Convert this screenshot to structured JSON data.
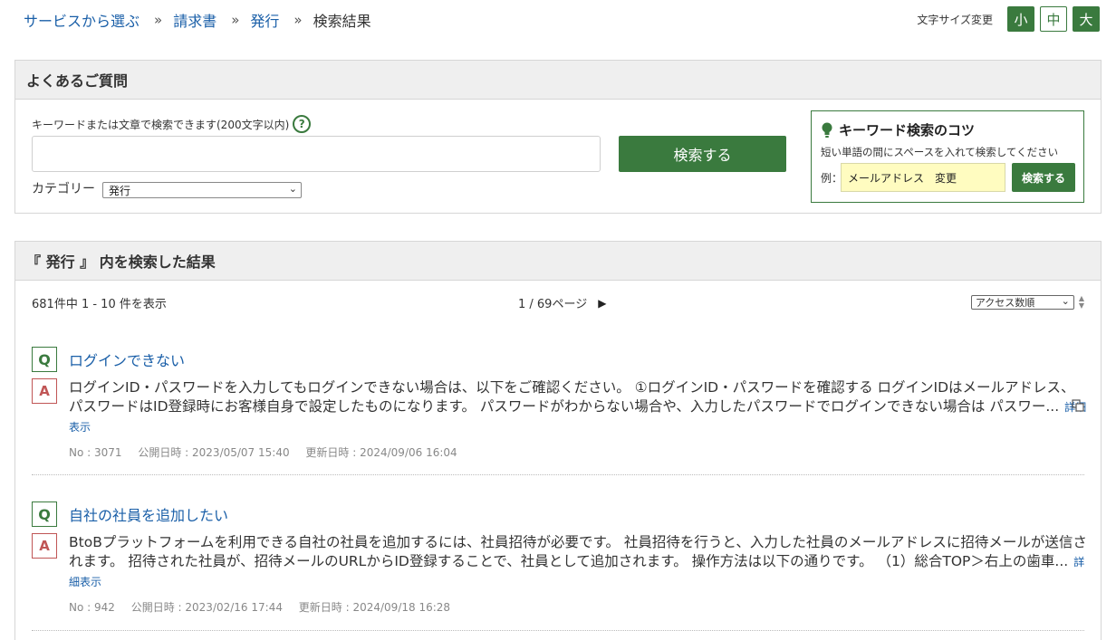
{
  "breadcrumb": {
    "items": [
      "サービスから選ぶ",
      "請求書",
      "発行"
    ],
    "separator": "»",
    "current": "検索結果"
  },
  "font_size": {
    "label": "文字サイズ変更",
    "small": "小",
    "medium": "中",
    "large": "大"
  },
  "faq": {
    "header": "よくあるご質問",
    "keyword_label": "キーワードまたは文章で検索できます(200文字以内)",
    "help_glyph": "?",
    "keyword_value": "",
    "search_button": "検索する",
    "category_label": "カテゴリー",
    "category_value": "発行",
    "tips": {
      "title": "キーワード検索のコツ",
      "description": "短い単語の間にスペースを入れて検索してください",
      "example_label": "例：",
      "example_value": "メールアドレス　変更",
      "button": "検索する"
    }
  },
  "results": {
    "header": "『 発行 』 内を検索した結果",
    "summary": "681件中 1 - 10 件を表示",
    "pager": "1 / 69ページ",
    "pager_next": "▶",
    "sort_value": "アクセス数順",
    "items": [
      {
        "q_badge": "Q",
        "a_badge": "A",
        "question": "ログインできない",
        "answer": "ログインID・パスワードを入力してもログインできない場合は、以下をご確認ください。 ①ログインID・パスワードを確認する ログインIDはメールアドレス、パスワードはID登録時にお客様自身で設定したものになります。 パスワードがわからない場合や、入力したパスワードでログインできない場合は パスワー...",
        "more": "詳細表示",
        "no": "No : 3071",
        "published": "公開日時 : 2023/05/07 15:40",
        "updated": "更新日時 : 2024/09/06 16:04"
      },
      {
        "q_badge": "Q",
        "a_badge": "A",
        "question": "自社の社員を追加したい",
        "answer": "BtoBプラットフォームを利用できる自社の社員を追加するには、社員招待が必要です。 社員招待を行うと、入力した社員のメールアドレスに招待メールが送信されます。 招待された社員が、招待メールのURLからID登録することで、社員として追加されます。 操作方法は以下の通りです。 （1）総合TOP＞右上の歯車...",
        "more": "詳細表示",
        "no": "No : 942",
        "published": "公開日時 : 2023/02/16 17:44",
        "updated": "更新日時 : 2024/09/18 16:28"
      }
    ]
  },
  "colors": {
    "accent_green": "#3a7a3e",
    "link_blue": "#1a5fa8",
    "answer_red": "#c05555",
    "tips_yellow": "#fffcc0"
  }
}
